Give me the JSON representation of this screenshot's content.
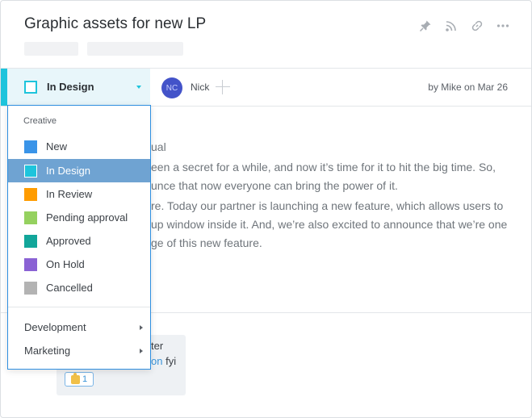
{
  "task": {
    "title": "Graphic assets for new LP",
    "byline": "by Mike on Mar 26"
  },
  "header_actions": [
    {
      "name": "pin-icon"
    },
    {
      "name": "rss-icon"
    },
    {
      "name": "link-icon"
    },
    {
      "name": "more-icon"
    }
  ],
  "status": {
    "current": "In Design",
    "color": "#1ec4dc"
  },
  "assignee": {
    "initials": "NC",
    "name": "Nick",
    "avatar_color": "#4353c9"
  },
  "body": {
    "lines": [
      "ual",
      "een a secret for a while, and now it’s time for it to hit the big time. So,",
      "unce that now everyone can bring the power of it.",
      "re. Today our partner is launching a new feature, which allows users to",
      "up window inside  it. And, we’re also excited to announce that we’re one",
      "ge of this new feature."
    ]
  },
  "comment": {
    "line1": "ter",
    "line2_mention": "on",
    "line2_rest": " fyi",
    "reaction_count": "1"
  },
  "dropdown": {
    "group_label": "Creative",
    "items": [
      {
        "label": "New",
        "color": "#3a94e8",
        "selected": false
      },
      {
        "label": "In Design",
        "color": "#1ec4dc",
        "selected": true
      },
      {
        "label": "In Review",
        "color": "#ff9c00",
        "selected": false
      },
      {
        "label": "Pending approval",
        "color": "#95d15f",
        "selected": false
      },
      {
        "label": "Approved",
        "color": "#12a69a",
        "selected": false
      },
      {
        "label": "On Hold",
        "color": "#8a62d4",
        "selected": false
      },
      {
        "label": "Cancelled",
        "color": "#b3b3b3",
        "selected": false
      }
    ],
    "submenus": [
      {
        "label": "Development"
      },
      {
        "label": "Marketing"
      }
    ]
  }
}
